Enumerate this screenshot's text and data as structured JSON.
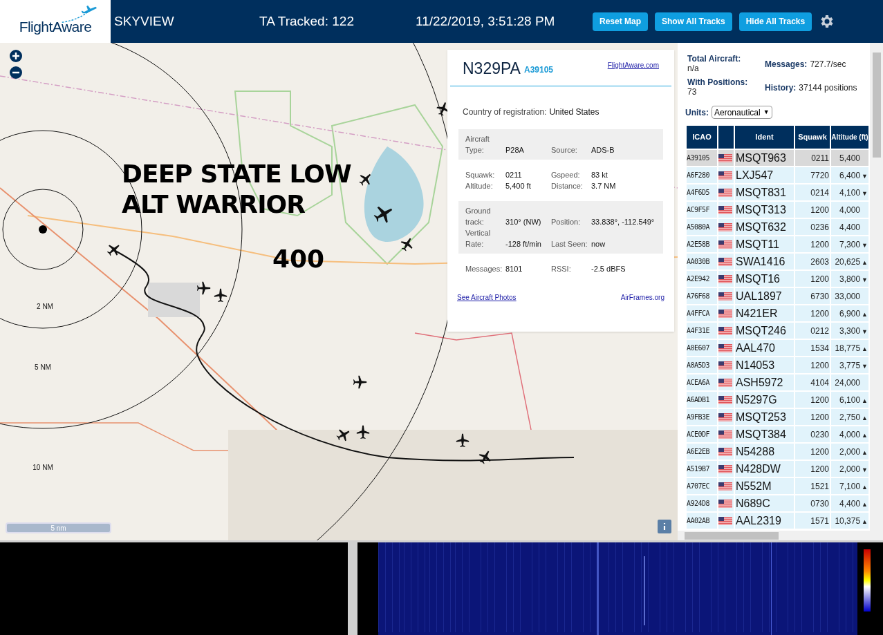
{
  "header": {
    "logo": "FlightAware",
    "title": "SKYVIEW",
    "tracked": "TA Tracked: 122",
    "datetime": "11/22/2019, 3:51:28 PM",
    "buttons": [
      "Reset Map",
      "Show All Tracks",
      "Hide All Tracks"
    ]
  },
  "map": {
    "range_labels": [
      "2 NM",
      "5 NM",
      "10 NM"
    ],
    "caption_lines": [
      "DEEP STATE LOW",
      "ALT WARRIOR"
    ],
    "caption_number": "400",
    "scale": "5 nm"
  },
  "popup": {
    "callsign": "N329PA",
    "hex": "A39105",
    "site_link": "FlightAware.com",
    "country_label": "Country of registration:",
    "country": "United States",
    "sections": [
      {
        "shaded": true,
        "rows": [
          [
            "Aircraft Type:",
            "P28A",
            "Source:",
            "ADS-B"
          ]
        ]
      },
      {
        "shaded": false,
        "rows": [
          [
            "Squawk:",
            "0211",
            "Gspeed:",
            "83 kt"
          ],
          [
            "Altitude:",
            "5,400 ft",
            "Distance:",
            "3.7 NM"
          ]
        ]
      },
      {
        "shaded": true,
        "rows": [
          [
            "Ground track:",
            "310° (NW)",
            "Position:",
            "33.838°, -112.549°"
          ],
          [
            "Vertical Rate:",
            "-128 ft/min",
            "Last Seen:",
            "now"
          ]
        ]
      },
      {
        "shaded": false,
        "rows": [
          [
            "Messages:",
            "8101",
            "RSSI:",
            "-2.5 dBFS"
          ]
        ]
      }
    ],
    "photos_link": "See Aircraft Photos",
    "airframes_link": "AirFrames.org"
  },
  "stats": [
    {
      "label": "Total Aircraft:",
      "value": "n/a"
    },
    {
      "label": "Messages:",
      "value": "727.7/sec"
    },
    {
      "label": "With Positions:",
      "value": "73"
    },
    {
      "label": "History:",
      "value": "37144 positions"
    }
  ],
  "units": {
    "label": "Units:",
    "value": "Aeronautical",
    "caret": "▼"
  },
  "table": {
    "columns": {
      "icao": "ICAO",
      "ident": "Ident",
      "squawk": "Squawk",
      "altitude": "Altitude (ft)"
    },
    "rows": [
      {
        "icao": "A39105",
        "ident": "MSQT963",
        "squawk": "0211",
        "altitude": "5,400",
        "selected": true
      },
      {
        "icao": "A6F280",
        "ident": "LXJ547",
        "squawk": "7720",
        "altitude": "6,400",
        "trend": "▼",
        "selected": false
      },
      {
        "icao": "A4F6D5",
        "ident": "MSQT831",
        "squawk": "0214",
        "altitude": "4,100",
        "trend": "▼",
        "selected": false
      },
      {
        "icao": "AC9F5F",
        "ident": "MSQT313",
        "squawk": "1200",
        "altitude": "4,000",
        "selected": false
      },
      {
        "icao": "A5080A",
        "ident": "MSQT632",
        "squawk": "0236",
        "altitude": "4,400",
        "selected": false
      },
      {
        "icao": "A2E58B",
        "ident": "MSQT11",
        "squawk": "1200",
        "altitude": "7,300",
        "trend": "▼",
        "selected": false
      },
      {
        "icao": "AA030B",
        "ident": "SWA1416",
        "squawk": "2603",
        "altitude": "20,625",
        "trend": "▲",
        "selected": false
      },
      {
        "icao": "A2E942",
        "ident": "MSQT16",
        "squawk": "1200",
        "altitude": "3,800",
        "trend": "▼",
        "selected": false
      },
      {
        "icao": "A76F68",
        "ident": "UAL1897",
        "squawk": "6730",
        "altitude": "33,000",
        "selected": false
      },
      {
        "icao": "A4FFCA",
        "ident": "N421ER",
        "squawk": "1200",
        "altitude": "6,900",
        "trend": "▲",
        "selected": false
      },
      {
        "icao": "A4F31E",
        "ident": "MSQT246",
        "squawk": "0212",
        "altitude": "3,300",
        "trend": "▼",
        "selected": false
      },
      {
        "icao": "A0E607",
        "ident": "AAL470",
        "squawk": "1534",
        "altitude": "18,775",
        "trend": "▲",
        "selected": false
      },
      {
        "icao": "A0A5D3",
        "ident": "N14053",
        "squawk": "1200",
        "altitude": "3,775",
        "trend": "▼",
        "selected": false
      },
      {
        "icao": "ACEA6A",
        "ident": "ASH5972",
        "squawk": "4104",
        "altitude": "24,000",
        "selected": false
      },
      {
        "icao": "A6ADB1",
        "ident": "N5297G",
        "squawk": "1200",
        "altitude": "6,100",
        "trend": "▲",
        "selected": false
      },
      {
        "icao": "A9FB3E",
        "ident": "MSQT253",
        "squawk": "1200",
        "altitude": "2,750",
        "trend": "▲",
        "selected": false
      },
      {
        "icao": "ACE0DF",
        "ident": "MSQT384",
        "squawk": "0230",
        "altitude": "4,000",
        "trend": "▲",
        "selected": false
      },
      {
        "icao": "A6E2EB",
        "ident": "N54288",
        "squawk": "1200",
        "altitude": "2,000",
        "trend": "▲",
        "selected": false
      },
      {
        "icao": "A519B7",
        "ident": "N428DW",
        "squawk": "1200",
        "altitude": "2,000",
        "trend": "▼",
        "selected": false
      },
      {
        "icao": "A707EC",
        "ident": "N552M",
        "squawk": "1521",
        "altitude": "7,100",
        "trend": "▲",
        "selected": false
      },
      {
        "icao": "A924D8",
        "ident": "N689C",
        "squawk": "0730",
        "altitude": "4,400",
        "trend": "▲",
        "selected": false
      },
      {
        "icao": "AA02AB",
        "ident": "AAL2319",
        "squawk": "1571",
        "altitude": "10,375",
        "trend": "▲",
        "selected": false
      }
    ]
  }
}
